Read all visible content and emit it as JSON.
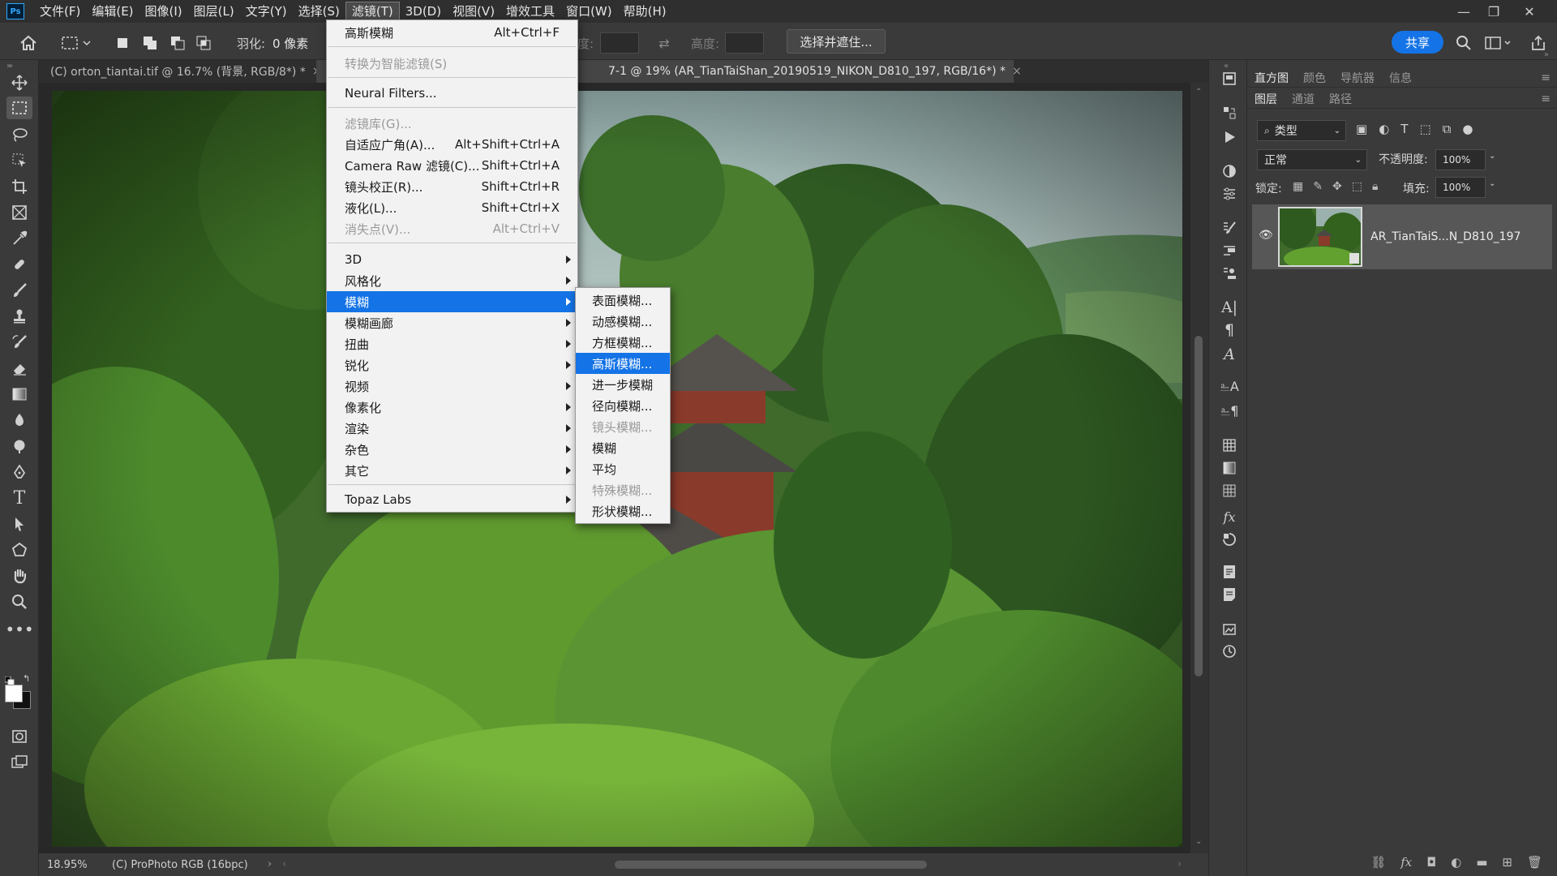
{
  "menubar": {
    "logo": "Ps",
    "items": [
      "文件(F)",
      "编辑(E)",
      "图像(I)",
      "图层(L)",
      "文字(Y)",
      "选择(S)",
      "滤镜(T)",
      "3D(D)",
      "视图(V)",
      "增效工具",
      "窗口(W)",
      "帮助(H)"
    ],
    "active_index": 6,
    "window_controls": [
      "—",
      "❐",
      "✕"
    ]
  },
  "options": {
    "feather_label": "羽化:",
    "feather_value": "0 像素",
    "width_label": "度:",
    "height_label": "高度:",
    "select_mask": "选择并遮住...",
    "share": "共享"
  },
  "tabs": [
    {
      "label": "(C) orton_tiantai.tif @ 16.7% (背景, RGB/8*) *",
      "close": "×"
    },
    {
      "label": "7-1 @ 19% (AR_TianTaiShan_20190519_NIKON_D810_197, RGB/16*) *",
      "close": "×"
    }
  ],
  "filter_menu": {
    "items": [
      {
        "label": "高斯模糊",
        "shortcut": "Alt+Ctrl+F"
      },
      {
        "label": "转换为智能滤镜(S)",
        "disabled": true
      },
      {
        "label": "Neural Filters..."
      },
      {
        "label": "滤镜库(G)...",
        "disabled": true
      },
      {
        "label": "自适应广角(A)...",
        "shortcut": "Alt+Shift+Ctrl+A"
      },
      {
        "label": "Camera Raw 滤镜(C)...",
        "shortcut": "Shift+Ctrl+A"
      },
      {
        "label": "镜头校正(R)...",
        "shortcut": "Shift+Ctrl+R"
      },
      {
        "label": "液化(L)...",
        "shortcut": "Shift+Ctrl+X"
      },
      {
        "label": "消失点(V)...",
        "shortcut": "Alt+Ctrl+V",
        "disabled": true
      },
      {
        "label": "3D",
        "submenu": true
      },
      {
        "label": "风格化",
        "submenu": true
      },
      {
        "label": "模糊",
        "submenu": true,
        "highlight": true
      },
      {
        "label": "模糊画廊",
        "submenu": true
      },
      {
        "label": "扭曲",
        "submenu": true
      },
      {
        "label": "锐化",
        "submenu": true
      },
      {
        "label": "视频",
        "submenu": true
      },
      {
        "label": "像素化",
        "submenu": true
      },
      {
        "label": "渲染",
        "submenu": true
      },
      {
        "label": "杂色",
        "submenu": true
      },
      {
        "label": "其它",
        "submenu": true
      },
      {
        "label": "Topaz Labs",
        "submenu": true
      }
    ]
  },
  "blur_submenu": {
    "items": [
      {
        "label": "表面模糊..."
      },
      {
        "label": "动感模糊..."
      },
      {
        "label": "方框模糊..."
      },
      {
        "label": "高斯模糊...",
        "highlight": true
      },
      {
        "label": "进一步模糊"
      },
      {
        "label": "径向模糊..."
      },
      {
        "label": "镜头模糊...",
        "disabled": true
      },
      {
        "label": "模糊"
      },
      {
        "label": "平均"
      },
      {
        "label": "特殊模糊...",
        "disabled": true
      },
      {
        "label": "形状模糊..."
      }
    ]
  },
  "panels": {
    "top_tabs": [
      "直方图",
      "颜色",
      "导航器",
      "信息"
    ],
    "layer_tabs": [
      "图层",
      "通道",
      "路径"
    ],
    "kind_filter": "类型",
    "blend_mode": "正常",
    "opacity_label": "不透明度:",
    "opacity_value": "100%",
    "lock_label": "锁定:",
    "fill_label": "填充:",
    "fill_value": "100%",
    "layer_name": "AR_TianTaiS...N_D810_197"
  },
  "status": {
    "zoom": "18.95%",
    "profile": "(C) ProPhoto RGB (16bpc)"
  },
  "colors": {
    "accent": "#1473e6",
    "menu_bg": "#f2f2f2",
    "chrome_dark": "#2f2f2f",
    "chrome": "#3a3a3a"
  }
}
